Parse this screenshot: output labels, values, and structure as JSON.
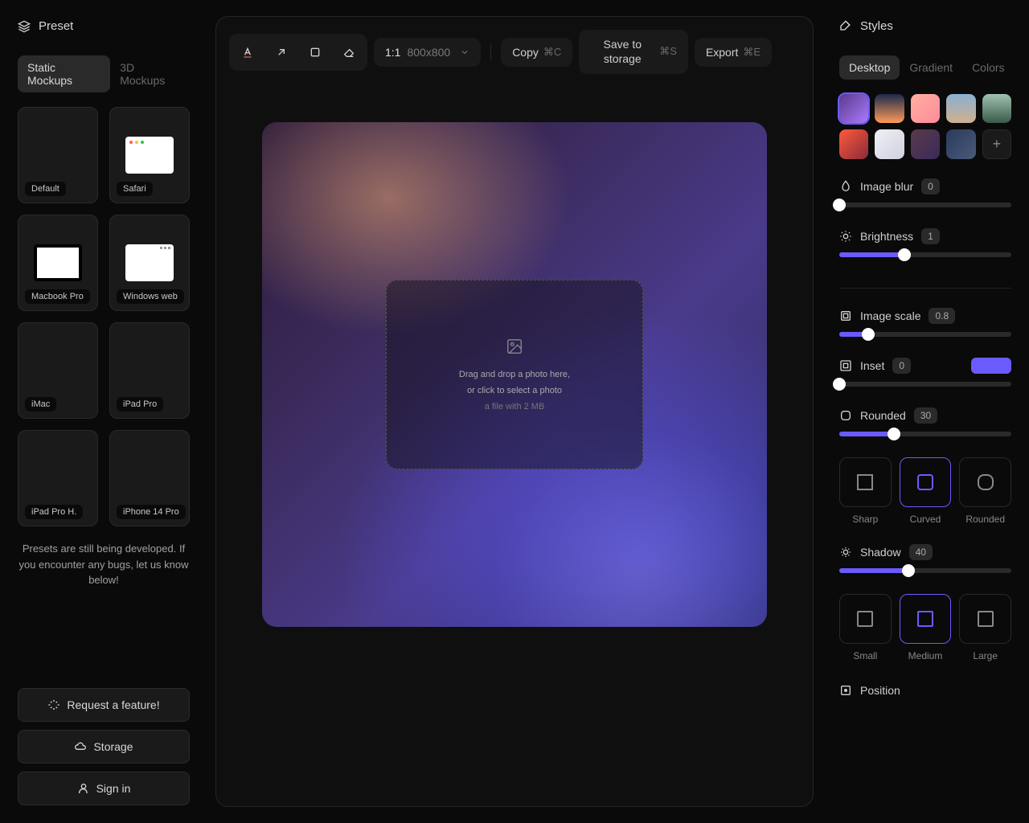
{
  "left": {
    "header": "Preset",
    "tabs": {
      "static": "Static Mockups",
      "threeD": "3D Mockups"
    },
    "presets": [
      {
        "label": "Default"
      },
      {
        "label": "Safari"
      },
      {
        "label": "Macbook Pro"
      },
      {
        "label": "Windows web"
      },
      {
        "label": "iMac"
      },
      {
        "label": "iPad Pro"
      },
      {
        "label": "iPad Pro H."
      },
      {
        "label": "iPhone 14 Pro"
      }
    ],
    "note": "Presets are still being developed. If you encounter any bugs, let us know below!",
    "buttons": {
      "request": "Request a feature!",
      "storage": "Storage",
      "signin": "Sign in"
    }
  },
  "toolbar": {
    "ratio": "1:1",
    "dims": "800x800",
    "copy": "Copy",
    "copy_sc": "⌘C",
    "save": "Save to storage",
    "save_sc": "⌘S",
    "export": "Export",
    "export_sc": "⌘E"
  },
  "dropzone": {
    "line1": "Drag and drop a photo here,",
    "line2": "or click to select a photo",
    "line3": "a file with 2 MB"
  },
  "right": {
    "header": "Styles",
    "tabs": {
      "desktop": "Desktop",
      "gradient": "Gradient",
      "colors": "Colors"
    },
    "image_blur": {
      "label": "Image blur",
      "value": "0",
      "pct": 0
    },
    "brightness": {
      "label": "Brightness",
      "value": "1",
      "pct": 38
    },
    "image_scale": {
      "label": "Image scale",
      "value": "0.8",
      "pct": 17
    },
    "inset": {
      "label": "Inset",
      "value": "0",
      "pct": 0
    },
    "rounded": {
      "label": "Rounded",
      "value": "30",
      "pct": 32,
      "opts": {
        "sharp": "Sharp",
        "curved": "Curved",
        "roundedOpt": "Rounded"
      }
    },
    "shadow": {
      "label": "Shadow",
      "value": "40",
      "pct": 40,
      "opts": {
        "small": "Small",
        "medium": "Medium",
        "large": "Large"
      }
    },
    "position": "Position",
    "thumb_colors": [
      "linear-gradient(135deg,#5a3a8a,#aa7aff)",
      "linear-gradient(180deg,#1a2a4a,#ff9a5a)",
      "linear-gradient(135deg,#ffb0a0,#ff8a9a)",
      "linear-gradient(180deg,#8ab0d0,#d0b090)",
      "linear-gradient(180deg,#a0c0b0,#3a5a4a)",
      "linear-gradient(135deg,#ff5a3a,#8a2a3a)",
      "linear-gradient(135deg,#f0f0f5,#d0d0e0)",
      "linear-gradient(135deg,#5a3a4a,#3a2a5a)",
      "linear-gradient(135deg,#2a3a5a,#4a5a7a)"
    ]
  }
}
